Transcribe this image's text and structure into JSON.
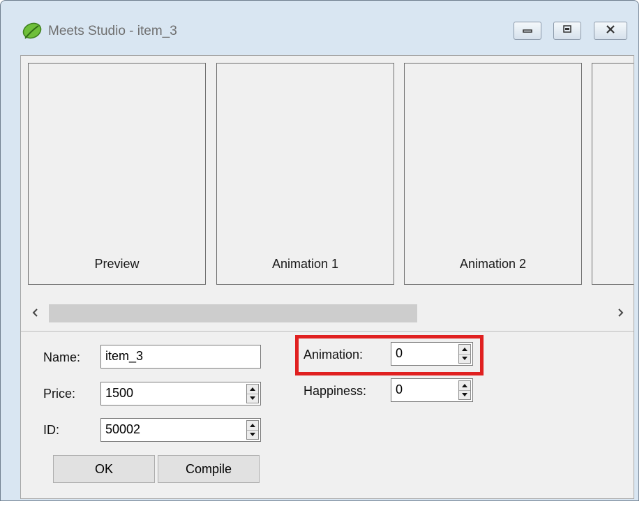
{
  "window": {
    "title": "Meets Studio - item_3"
  },
  "strip": {
    "panels": [
      "Preview",
      "Animation 1",
      "Animation 2",
      ""
    ]
  },
  "form": {
    "name_label": "Name:",
    "name_value": "item_3",
    "price_label": "Price:",
    "price_value": "1500",
    "id_label": "ID:",
    "id_value": "50002",
    "animation_label": "Animation:",
    "animation_value": "0",
    "happiness_label": "Happiness:",
    "happiness_value": "0"
  },
  "buttons": {
    "ok_label": "OK",
    "compile_label": "Compile"
  },
  "colors": {
    "highlight": "#e02020",
    "titlebar": "#d9e6f2",
    "client_bg": "#f0f0f0"
  },
  "icons": {
    "app": "leaf-icon",
    "scroll_left": "chevron-left-icon",
    "scroll_right": "chevron-right-icon",
    "spinner": "spin-up-down-icon"
  }
}
